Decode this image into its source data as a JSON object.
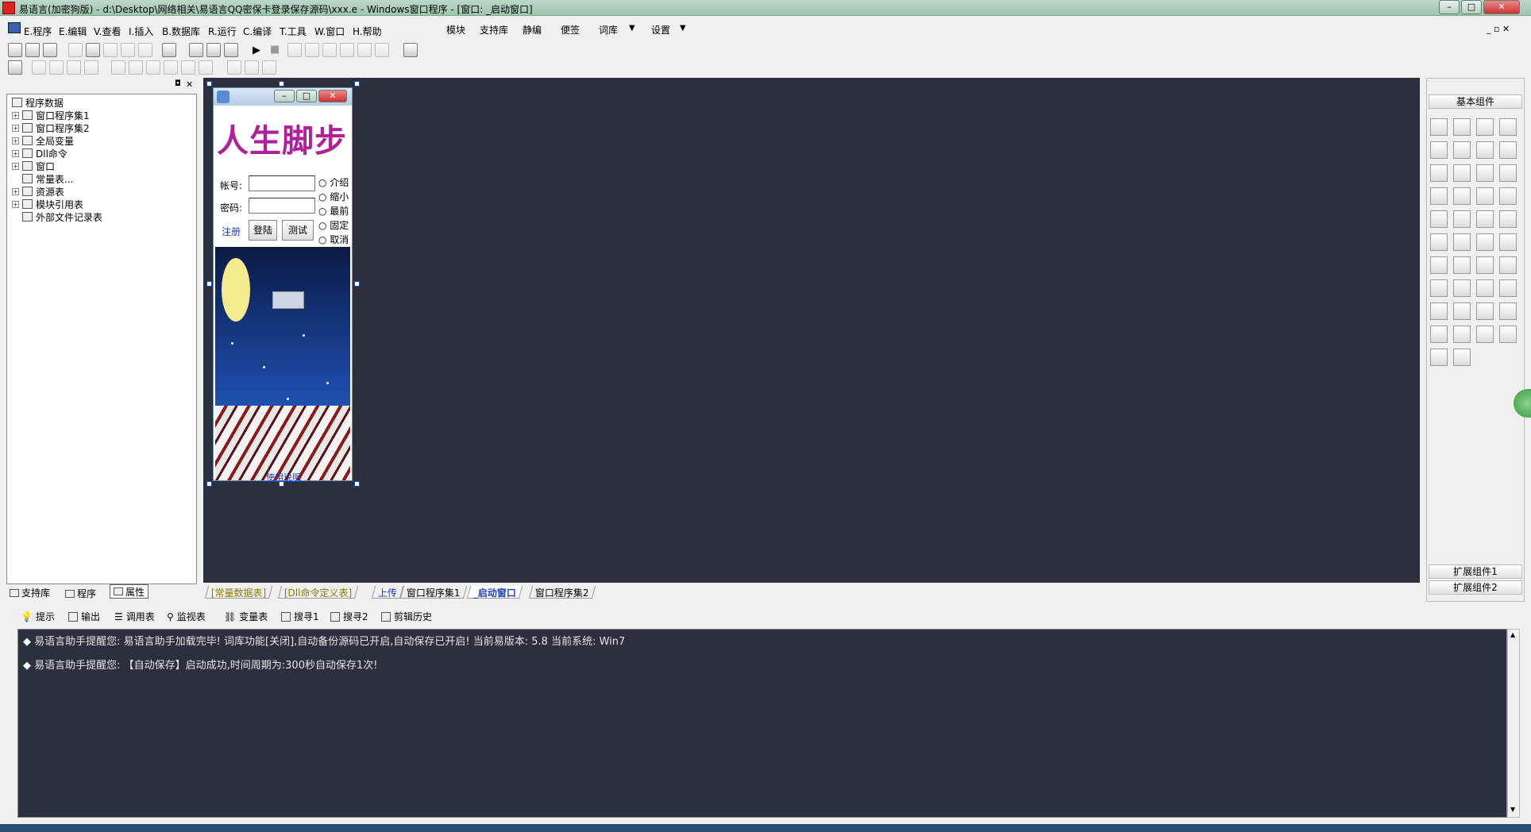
{
  "window": {
    "title": "易语言(加密狗版) - d:\\Desktop\\网络相关\\易语言QQ密保卡登录保存源码\\xxx.e - Windows窗口程序 - [窗口: _启动窗口]"
  },
  "menu": {
    "items": [
      "E.程序",
      "E.编辑",
      "V.查看",
      "I.插入",
      "B.数据库",
      "R.运行",
      "C.编译",
      "T.工具",
      "W.窗口",
      "H.帮助"
    ],
    "right_items": [
      "模块",
      "支持库",
      "静编",
      "便签",
      "词库",
      "设置"
    ]
  },
  "tree": {
    "root": "程序数据",
    "items": [
      "窗口程序集1",
      "窗口程序集2",
      "全局变量",
      "Dll命令",
      "窗口",
      "常量表...",
      "资源表",
      "模块引用表",
      "外部文件记录表"
    ]
  },
  "left_tabs": [
    "支持库",
    "程序",
    "属性"
  ],
  "form": {
    "banner": "人生脚步",
    "account_label": "帐号:",
    "password_label": "密码:",
    "radios": [
      "介绍",
      "缩小",
      "最前",
      "固定",
      "取消"
    ],
    "register_label": "注册",
    "login_label": "登陆",
    "test_label": "测试",
    "usage_label": "使用说明"
  },
  "editor_tabs": [
    "[常量数据表]",
    "[Dll命令定义表]",
    "上传",
    "窗口程序集1",
    "_启动窗口",
    "窗口程序集2"
  ],
  "right_panel": {
    "header": "基本组件",
    "ext1": "扩展组件1",
    "ext2": "扩展组件2"
  },
  "output_tabs": [
    "提示",
    "输出",
    "调用表",
    "监视表",
    "变量表",
    "搜寻1",
    "搜寻2",
    "剪辑历史"
  ],
  "output_lines": [
    "易语言助手提醒您:  易语言助手加载完毕!  词库功能[关闭],自动备份源码已开启,自动保存已开启!  当前易版本: 5.8  当前系统: Win7",
    "易语言助手提醒您: 【自动保存】启动成功,时间周期为:300秒自动保存1次!"
  ],
  "colors": {
    "editor_bg": "#2c2f3d",
    "banner": "#b0209a",
    "sky_top": "#0a1a45",
    "sky_bottom": "#2a6fd6"
  }
}
